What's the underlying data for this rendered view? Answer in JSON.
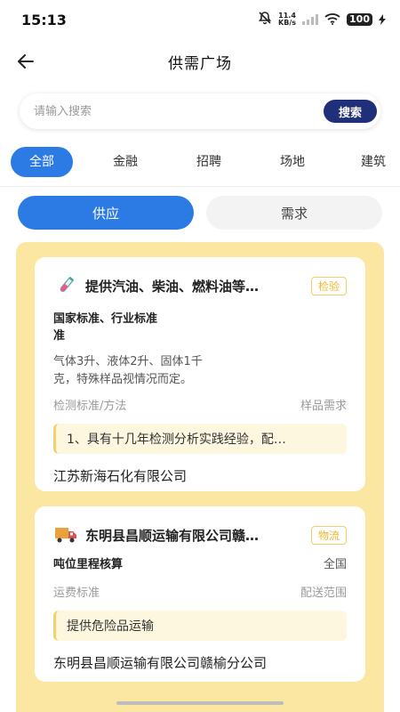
{
  "status_bar": {
    "time": "15:13",
    "net_speed_value": "11.4",
    "net_speed_unit": "KB/s",
    "battery": "100",
    "icons": [
      "mute-bell-icon",
      "signal-icon",
      "wifi-icon",
      "battery-icon",
      "charging-icon"
    ]
  },
  "nav": {
    "title": "供需广场",
    "back_icon": "back-arrow-icon"
  },
  "search": {
    "placeholder": "请输入搜索",
    "value": "",
    "button_label": "搜索"
  },
  "categories": [
    {
      "label": "全部",
      "active": true
    },
    {
      "label": "金融",
      "active": false
    },
    {
      "label": "招聘",
      "active": false
    },
    {
      "label": "场地",
      "active": false
    },
    {
      "label": "建筑",
      "active": false
    }
  ],
  "segments": {
    "supply_label": "供应",
    "demand_label": "需求",
    "active": "供应"
  },
  "cards": [
    {
      "icon": "test-tube-icon",
      "title": "提供汽油、柴油、燃料油等…",
      "tag": "检验",
      "standard": "国家标准、行业标准",
      "standard_wrap": "准",
      "sample_line1": "气体3升、液体2升、固体1千",
      "sample_line2": "克，特殊样品视情况而定。",
      "label_left": "检测标准/方法",
      "label_right": "样品需求",
      "note": "1、具有十几年检测分析实践经验，配…",
      "company": "江苏新海石化有限公司"
    },
    {
      "icon": "delivery-truck-icon",
      "title": "东明县昌顺运输有限公司赣…",
      "tag": "物流",
      "value_left": "吨位里程核算",
      "value_right": "全国",
      "label_left": "运费标准",
      "label_right": "配送范围",
      "note": "提供危险品运输",
      "company": "东明县昌顺运输有限公司赣榆分公司"
    }
  ],
  "colors": {
    "primary": "#2c7be5",
    "search_button": "#1f2f7a",
    "panel_bg": "#fbe7a1",
    "tag": "#f0b830",
    "note_bg": "#fef7e0"
  }
}
